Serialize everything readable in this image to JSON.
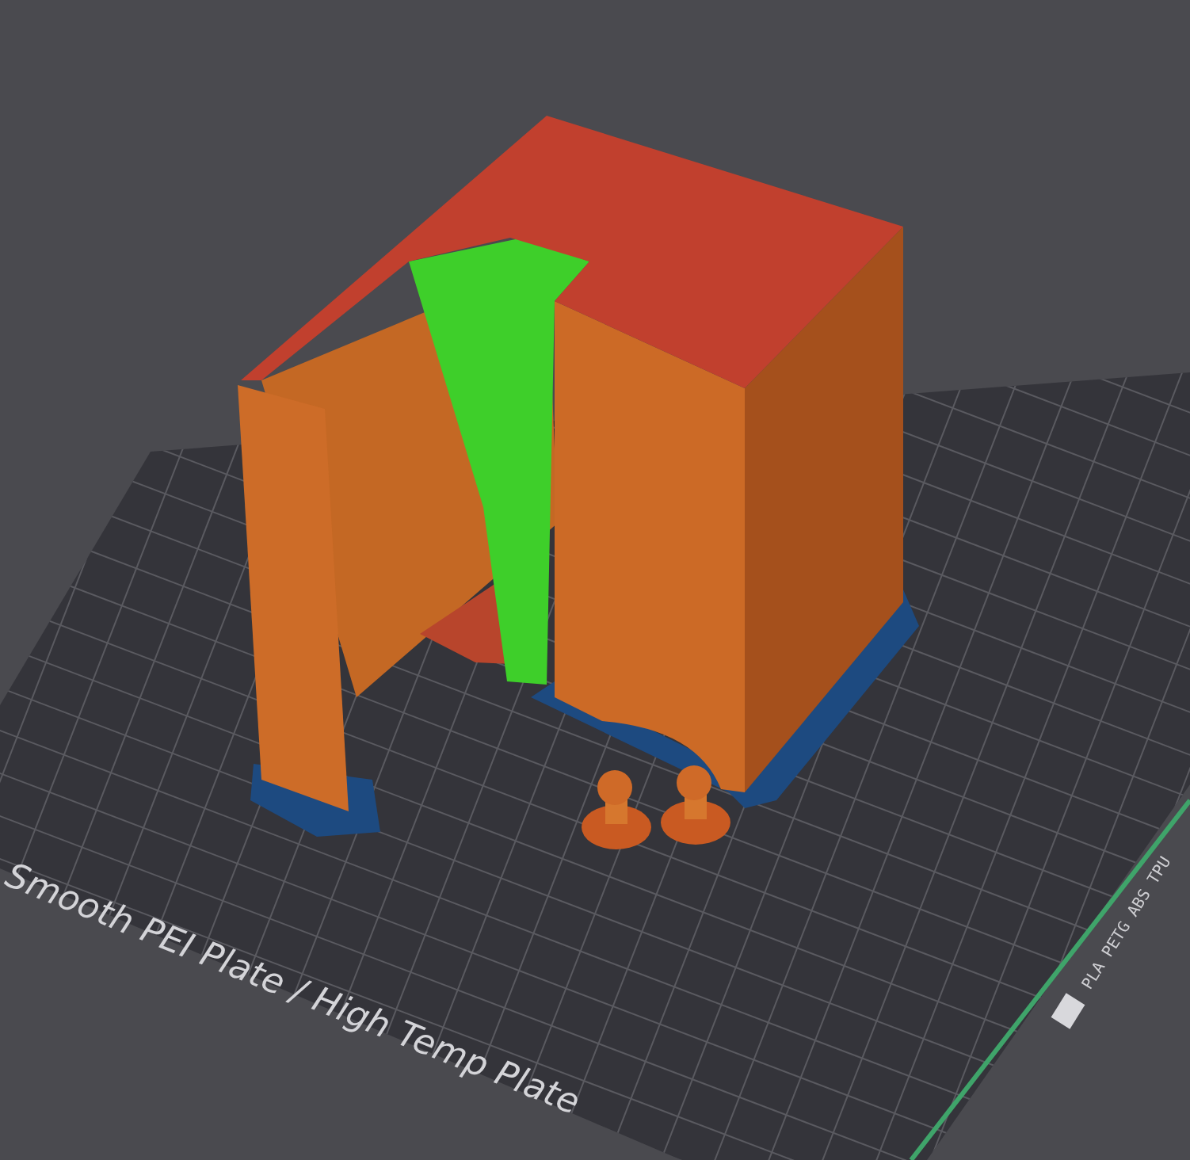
{
  "viewport": {
    "plate_label": "Smooth PEI Plate / High Temp Plate",
    "filament_label": "PLA PETG ABS TPU"
  }
}
